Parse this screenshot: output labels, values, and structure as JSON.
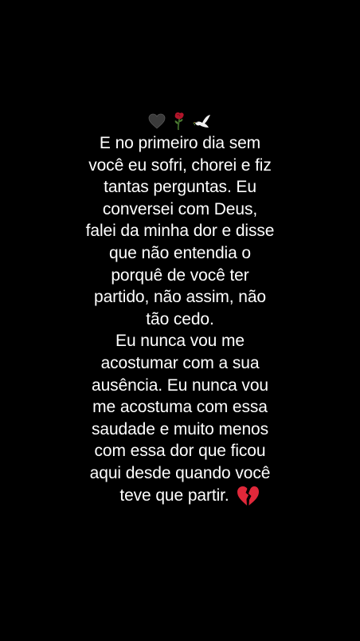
{
  "icons": [
    "black-heart-icon",
    "wilted-rose-icon",
    "dove-icon"
  ],
  "lines": [
    "E no primeiro dia sem",
    "você eu sofri, chorei e fiz",
    "tantas perguntas. Eu",
    "conversei com Deus,",
    "falei da minha dor e disse",
    "que não entendia o",
    "porquê de você ter",
    "partido, não assim, não",
    "tão cedo.",
    "Eu nunca vou me",
    "acostumar com a sua",
    "ausência. Eu nunca vou",
    "me acostuma com essa",
    "saudade e muito menos",
    "com essa dor que ficou",
    "aqui desde quando você"
  ],
  "last_line": "teve que partir.",
  "last_icon": "broken-heart-icon",
  "colors": {
    "background": "#000000",
    "text": "#ffffff",
    "broken_heart": "#e0283a",
    "black_heart": "#3a3a3a"
  }
}
